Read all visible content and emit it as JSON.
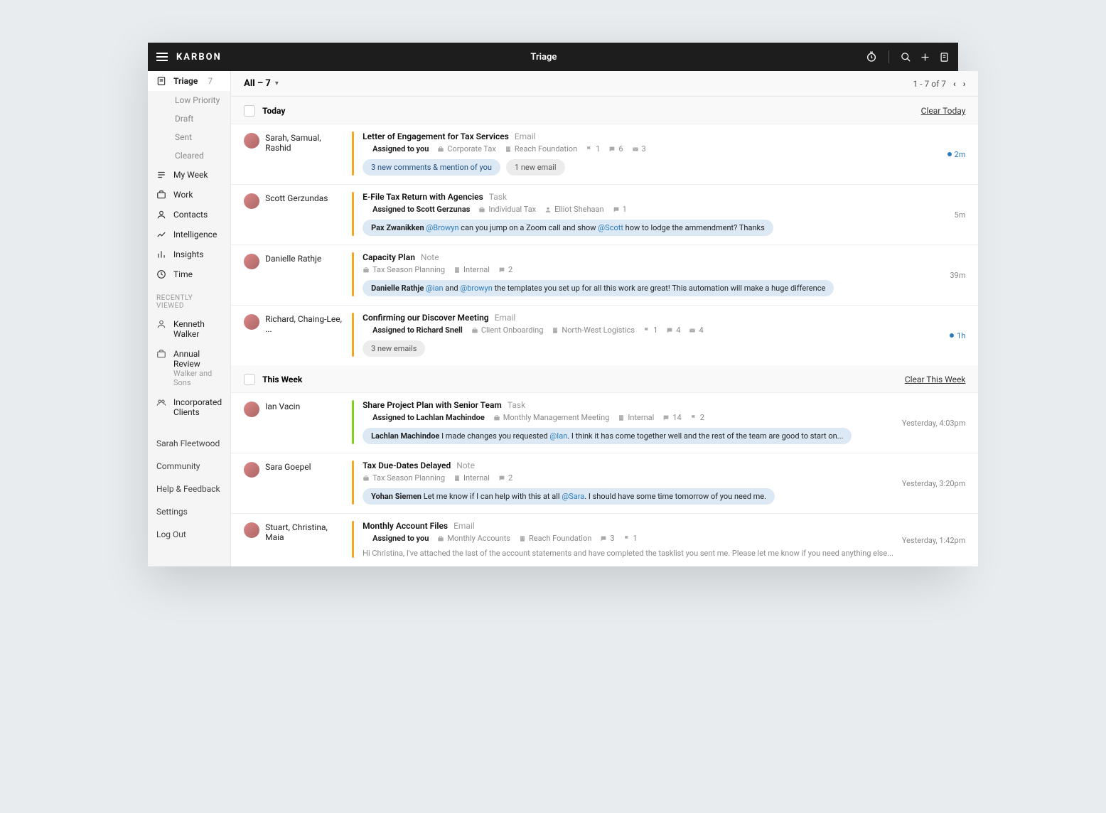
{
  "brand": "KARBON",
  "page_title": "Triage",
  "sidebar": {
    "nav": [
      {
        "label": "Triage",
        "count": "7",
        "active": true
      },
      {
        "label": "My Week"
      },
      {
        "label": "Work"
      },
      {
        "label": "Contacts"
      },
      {
        "label": "Intelligence"
      },
      {
        "label": "Insights"
      },
      {
        "label": "Time"
      }
    ],
    "triage_sub": [
      "Low Priority",
      "Draft",
      "Sent",
      "Cleared"
    ],
    "recent_label": "RECENTLY VIEWED",
    "recent": [
      {
        "label": "Kenneth Walker"
      },
      {
        "label": "Annual Review",
        "sub": "Walker and Sons"
      },
      {
        "label": "Incorporated Clients"
      }
    ],
    "footer": [
      "Sarah Fleetwood",
      "Community",
      "Help & Feedback",
      "Settings",
      "Log Out"
    ]
  },
  "filter": {
    "label": "All – 7",
    "pager": "1 - 7 of 7"
  },
  "sections": [
    {
      "label": "Today",
      "clear": "Clear Today",
      "items": [
        {
          "people": "Sarah, Samual, Rashid",
          "bar": "orange",
          "subject": "Letter of Engagement for Tax Services",
          "type": "Email",
          "time": "2m",
          "unread": true,
          "assigned": "Assigned to you",
          "chips": [
            {
              "icon": "briefcase",
              "text": "Corporate Tax"
            },
            {
              "icon": "building",
              "text": "Reach Foundation"
            },
            {
              "icon": "flag",
              "text": "1"
            },
            {
              "icon": "comment",
              "text": "6"
            },
            {
              "icon": "mail",
              "text": "3"
            }
          ],
          "pills": [
            {
              "style": "blue",
              "text": "3 new comments & mention of you"
            },
            {
              "style": "gray",
              "text": "1 new email"
            }
          ]
        },
        {
          "people": "Scott Gerzundas",
          "bar": "orange",
          "subject": "E-File Tax Return with Agencies",
          "type": "Task",
          "time": "5m",
          "assigned": "Assigned to Scott Gerzunas",
          "chips": [
            {
              "icon": "briefcase",
              "text": "Individual Tax"
            },
            {
              "icon": "person",
              "text": "Elliot Shehaan"
            },
            {
              "icon": "comment",
              "text": "1"
            }
          ],
          "mention": {
            "author": "Pax Zwanikken",
            "parts": [
              {
                "at": "@Browyn"
              },
              {
                "t": " can you jump on a Zoom call and show "
              },
              {
                "at": "@Scott"
              },
              {
                "t": " how to lodge the ammendment? Thanks"
              }
            ]
          }
        },
        {
          "people": "Danielle Rathje",
          "bar": "orange",
          "subject": "Capacity Plan",
          "type": "Note",
          "time": "39m",
          "chips": [
            {
              "icon": "briefcase",
              "text": "Tax Season Planning"
            },
            {
              "icon": "building",
              "text": "Internal"
            },
            {
              "icon": "comment",
              "text": "2"
            }
          ],
          "mention": {
            "author": "Danielle Rathje",
            "parts": [
              {
                "at": "@ian"
              },
              {
                "t": " and "
              },
              {
                "at": "@browyn"
              },
              {
                "t": " the templates you set up for all this work are great! This automation will make a huge difference"
              }
            ]
          }
        },
        {
          "people": "Richard, Chaing-Lee, ...",
          "bar": "orange",
          "subject": "Confirming our Discover Meeting",
          "type": "Email",
          "time": "1h",
          "unread": true,
          "assigned": "Assigned to Richard Snell",
          "chips": [
            {
              "icon": "briefcase",
              "text": "Client Onboarding"
            },
            {
              "icon": "building",
              "text": "North-West Logistics"
            },
            {
              "icon": "flag",
              "text": "1"
            },
            {
              "icon": "comment",
              "text": "4"
            },
            {
              "icon": "mail",
              "text": "4"
            }
          ],
          "pills": [
            {
              "style": "gray",
              "text": "3 new emails"
            }
          ]
        }
      ]
    },
    {
      "label": "This Week",
      "clear": "Clear This Week",
      "items": [
        {
          "people": "Ian Vacin",
          "bar": "green",
          "subject": "Share Project Plan with Senior Team",
          "type": "Task",
          "time": "Yesterday, 4:03pm",
          "assigned": "Assigned to Lachlan Machindoe",
          "chips": [
            {
              "icon": "briefcase",
              "text": "Monthly Management Meeting"
            },
            {
              "icon": "building",
              "text": "Internal"
            },
            {
              "icon": "comment",
              "text": "14"
            },
            {
              "icon": "flag",
              "text": "2"
            }
          ],
          "mention": {
            "author": "Lachlan Machindoe",
            "parts": [
              {
                "t": " I made changes you requested "
              },
              {
                "at": "@Ian"
              },
              {
                "t": ". I think it has come together well and the rest of the team are good to start on..."
              }
            ]
          }
        },
        {
          "people": "Sara Goepel",
          "bar": "orange",
          "subject": "Tax Due-Dates Delayed",
          "type": "Note",
          "time": "Yesterday, 3:20pm",
          "chips": [
            {
              "icon": "briefcase",
              "text": "Tax Season Planning"
            },
            {
              "icon": "building",
              "text": "Internal"
            },
            {
              "icon": "comment",
              "text": "2"
            }
          ],
          "mention": {
            "author": "Yohan Siemen",
            "parts": [
              {
                "t": " Let me know if I can help with this at all "
              },
              {
                "at": "@Sara"
              },
              {
                "t": ". I should have some time tomorrow of you need me."
              }
            ]
          }
        },
        {
          "people": "Stuart, Christina, Maia",
          "bar": "orange",
          "subject": "Monthly Account Files",
          "type": "Email",
          "time": "Yesterday, 1:42pm",
          "assigned": "Assigned to you",
          "chips": [
            {
              "icon": "briefcase",
              "text": "Monthly Accounts"
            },
            {
              "icon": "building",
              "text": "Reach Foundation"
            },
            {
              "icon": "comment",
              "text": "3"
            },
            {
              "icon": "flag",
              "text": "1"
            }
          ],
          "snippet": "Hi Christina, I've attached the last of the account statements and have completed the tasklist you sent me. Please let me know if you need anything else..."
        }
      ]
    }
  ]
}
